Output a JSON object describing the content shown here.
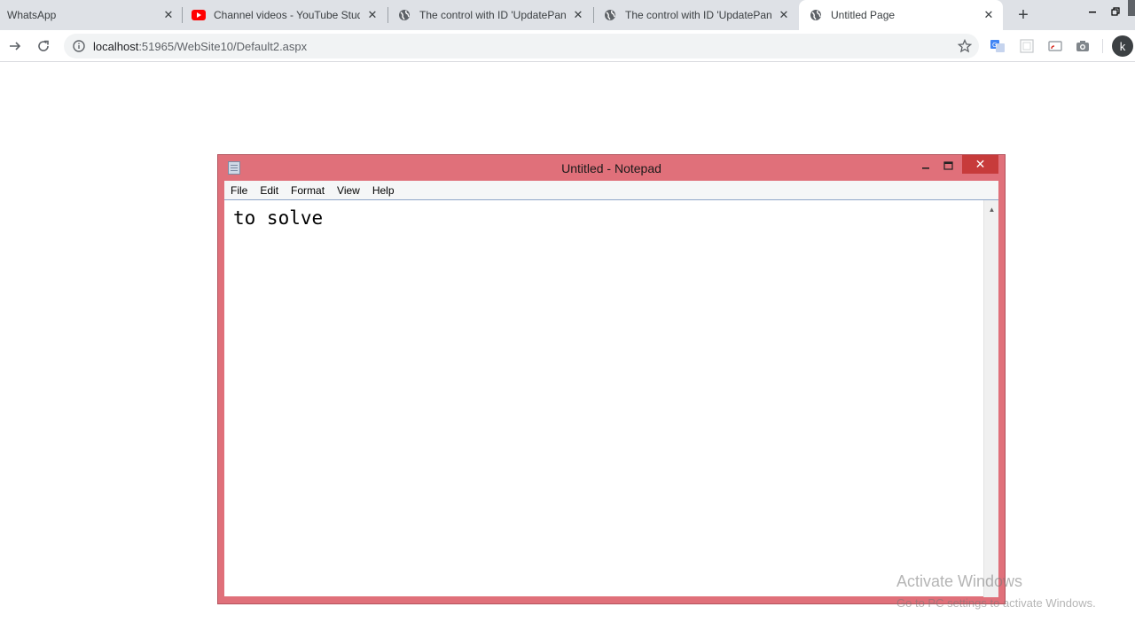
{
  "browser": {
    "tabs": [
      {
        "title": "WhatsApp",
        "icon": "whatsapp-icon",
        "active": false
      },
      {
        "title": "Channel videos - YouTube Studi",
        "icon": "youtube-icon",
        "active": false
      },
      {
        "title": "The control with ID 'UpdatePane",
        "icon": "globe-icon",
        "active": false
      },
      {
        "title": "The control with ID 'UpdatePane",
        "icon": "globe-icon",
        "active": false
      },
      {
        "title": "Untitled Page",
        "icon": "globe-icon",
        "active": true
      }
    ],
    "address": {
      "host": "localhost",
      "rest": ":51965/WebSite10/Default2.aspx"
    },
    "profile_initial": "k"
  },
  "notepad": {
    "title": "Untitled - Notepad",
    "menu": [
      "File",
      "Edit",
      "Format",
      "View",
      "Help"
    ],
    "content": "to solve",
    "accent_color": "#e0707a"
  },
  "watermark": {
    "title": "Activate Windows",
    "subtitle": "Go to PC settings to activate Windows."
  }
}
